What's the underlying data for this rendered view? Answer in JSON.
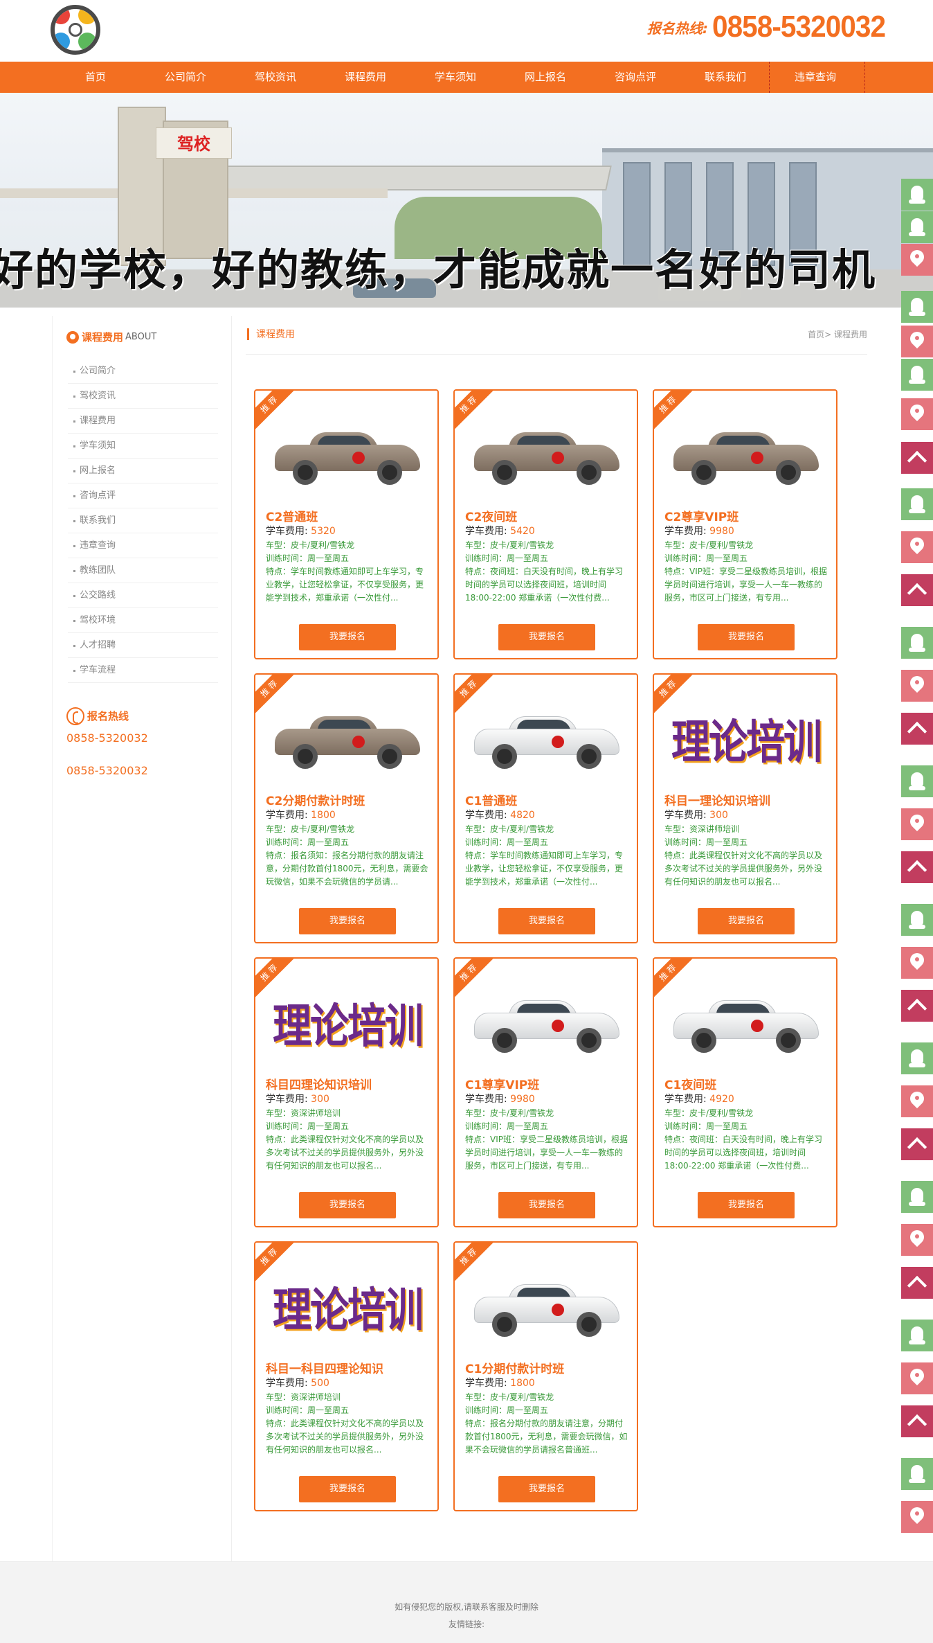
{
  "header": {
    "hotline_label": "报名热线:",
    "hotline_number": "0858-5320032"
  },
  "nav": {
    "items": [
      "首页",
      "公司简介",
      "驾校资讯",
      "课程费用",
      "学车须知",
      "网上报名",
      "咨询点评",
      "联系我们",
      "违章查询"
    ]
  },
  "banner": {
    "slogan": "好的学校，好的教练，才能成就一名好的司机",
    "gate_sign": "驾校"
  },
  "sidebar": {
    "title": "课程费用",
    "title_en": "ABOUT",
    "items": [
      "公司简介",
      "驾校资讯",
      "课程费用",
      "学车须知",
      "网上报名",
      "咨询点评",
      "联系我们",
      "违章查询",
      "教练团队",
      "公交路线",
      "驾校环境",
      "人才招聘",
      "学车流程"
    ],
    "hotline_title": "报名热线",
    "phone1": "0858-5320032",
    "phone2": "0858-5320032"
  },
  "main": {
    "current": "课程费用",
    "breadcrumb": "首页> 课程费用"
  },
  "cards": [
    {
      "tag": "推荐",
      "image": "gold-car",
      "name": "C2普通班",
      "price_label": "学车费用:",
      "price": "5320",
      "car": "车型：皮卡/夏利/雪铁龙",
      "time": "训练时间：周一至周五",
      "desc": "特点：学车时间教练通知即可上车学习，专业教学，让您轻松拿证，不仅享受服务，更能学到技术，郑重承诺（一次性付...",
      "button": "我要报名"
    },
    {
      "tag": "推荐",
      "image": "gold-car",
      "name": "C2夜间班",
      "price_label": "学车费用:",
      "price": "5420",
      "car": "车型：皮卡/夏利/雪铁龙",
      "time": "训练时间：周一至周五",
      "desc": "特点：夜间班：白天没有时间，晚上有学习时间的学员可以选择夜间班，培训时间 18:00-22:00 郑重承诺（一次性付费...",
      "button": "我要报名"
    },
    {
      "tag": "推荐",
      "image": "gold-car",
      "name": "C2尊享VIP班",
      "price_label": "学车费用:",
      "price": "9980",
      "car": "车型：皮卡/夏利/雪铁龙",
      "time": "训练时间：周一至周五",
      "desc": "特点：VIP班：享受二星级教练员培训，根据学员时间进行培训，享受一人一车一教练的服务，市区可上门接送，有专用...",
      "button": "我要报名"
    },
    {
      "tag": "推荐",
      "image": "gold-car",
      "name": "C2分期付款计时班",
      "price_label": "学车费用:",
      "price": "1800",
      "car": "车型：皮卡/夏利/雪铁龙",
      "time": "训练时间：周一至周五",
      "desc": "特点：报名须知：报名分期付款的朋友请注意，分期付款首付1800元，无利息，需要会玩微信，如果不会玩微信的学员请...",
      "button": "我要报名"
    },
    {
      "tag": "推荐",
      "image": "white-car",
      "name": "C1普通班",
      "price_label": "学车费用:",
      "price": "4820",
      "car": "车型：皮卡/夏利/雪铁龙",
      "time": "训练时间：周一至周五",
      "desc": "特点：学车时间教练通知即可上车学习，专业教学，让您轻松拿证，不仅享受服务，更能学到技术，郑重承诺（一次性付...",
      "button": "我要报名"
    },
    {
      "tag": "推荐",
      "image": "theory",
      "image_text": "理论培训",
      "name": "科目一理论知识培训",
      "price_label": "学车费用:",
      "price": "300",
      "car": "车型：资深讲师培训",
      "time": "训练时间：周一至周五",
      "desc": "特点：此类课程仅针对文化不高的学员以及多次考试不过关的学员提供服务外，另外没有任何知识的朋友也可以报名...",
      "button": "我要报名"
    },
    {
      "tag": "推荐",
      "image": "theory",
      "image_text": "理论培训",
      "name": "科目四理论知识培训",
      "price_label": "学车费用:",
      "price": "300",
      "car": "车型：资深讲师培训",
      "time": "训练时间：周一至周五",
      "desc": "特点：此类课程仅针对文化不高的学员以及多次考试不过关的学员提供服务外，另外没有任何知识的朋友也可以报名...",
      "button": "我要报名"
    },
    {
      "tag": "推荐",
      "image": "white-car",
      "name": "C1尊享VIP班",
      "price_label": "学车费用:",
      "price": "9980",
      "car": "车型：皮卡/夏利/雪铁龙",
      "time": "训练时间：周一至周五",
      "desc": "特点：VIP班：享受二星级教练员培训，根据学员时间进行培训，享受一人一车一教练的服务，市区可上门接送，有专用...",
      "button": "我要报名"
    },
    {
      "tag": "推荐",
      "image": "white-car",
      "name": "C1夜间班",
      "price_label": "学车费用:",
      "price": "4920",
      "car": "车型：皮卡/夏利/雪铁龙",
      "time": "训练时间：周一至周五",
      "desc": "特点：夜间班：白天没有时间，晚上有学习时间的学员可以选择夜间班，培训时间 18:00-22:00 郑重承诺（一次性付费...",
      "button": "我要报名"
    },
    {
      "tag": "推荐",
      "image": "theory",
      "image_text": "理论培训",
      "name": "科目一科目四理论知识",
      "price_label": "学车费用:",
      "price": "500",
      "car": "车型：资深讲师培训",
      "time": "训练时间：周一至周五",
      "desc": "特点：此类课程仅针对文化不高的学员以及多次考试不过关的学员提供服务外，另外没有任何知识的朋友也可以报名...",
      "button": "我要报名"
    },
    {
      "tag": "推荐",
      "image": "white-car",
      "name": "C1分期付款计时班",
      "price_label": "学车费用:",
      "price": "1800",
      "car": "车型：皮卡/夏利/雪铁龙",
      "time": "训练时间：周一至周五",
      "desc": "特点：报名分期付款的朋友请注意，分期付款首付1800元，无利息，需要会玩微信，如果不会玩微信的学员请报名普通班...",
      "button": "我要报名"
    }
  ],
  "footer": {
    "line1": "如有侵犯您的版权,请联系客服及时删除",
    "line2": "友情链接:"
  },
  "colors": {
    "accent": "#f36f21",
    "green_text": "#3a9a3a",
    "float_qq": "#7fbf7a",
    "float_loc": "#e5757d",
    "float_top": "#c23d5f"
  },
  "float_icons": [
    "qq-icon",
    "location-icon",
    "back-to-top-icon"
  ]
}
